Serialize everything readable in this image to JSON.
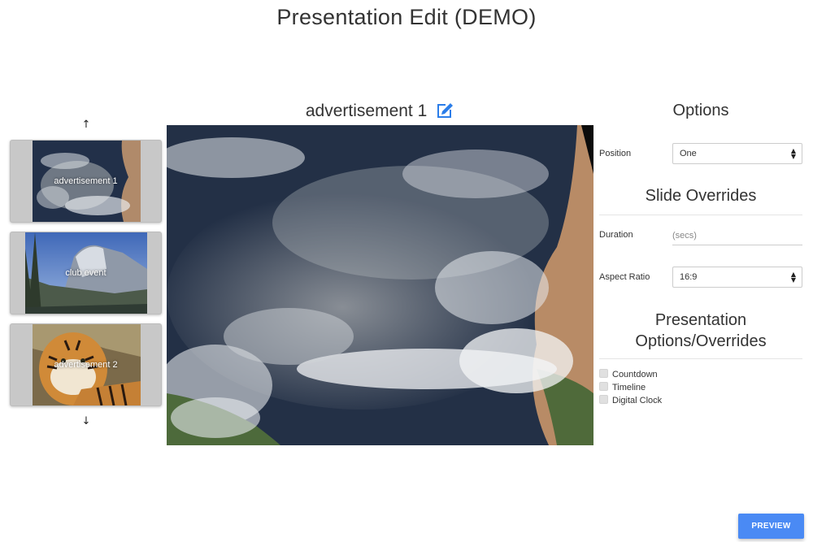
{
  "page": {
    "title": "Presentation Edit (DEMO)"
  },
  "thumbnails": {
    "up_arrow": "↑",
    "down_arrow": "↓",
    "items": [
      {
        "label": "advertisement 1",
        "image": "satellite-ocean"
      },
      {
        "label": "club event",
        "image": "mountain-valley"
      },
      {
        "label": "advertisement 2",
        "image": "tiger"
      }
    ]
  },
  "slide": {
    "name": "advertisement 1",
    "edit_icon": "edit-icon",
    "image": "satellite-ocean"
  },
  "options": {
    "heading": "Options",
    "position": {
      "label": "Position",
      "value": "One"
    }
  },
  "slide_overrides": {
    "heading": "Slide Overrides",
    "duration": {
      "label": "Duration",
      "placeholder": "(secs)"
    },
    "aspect_ratio": {
      "label": "Aspect Ratio",
      "value": "16:9"
    }
  },
  "presentation_overrides": {
    "heading_line1": "Presentation",
    "heading_line2": "Options/Overrides",
    "checkboxes": [
      {
        "label": "Countdown",
        "checked": false
      },
      {
        "label": "Timeline",
        "checked": false
      },
      {
        "label": "Digital Clock",
        "checked": false
      }
    ]
  },
  "actions": {
    "preview_label": "PREVIEW"
  },
  "colors": {
    "accent": "#4a8af4",
    "edit_icon": "#2b7de9"
  }
}
